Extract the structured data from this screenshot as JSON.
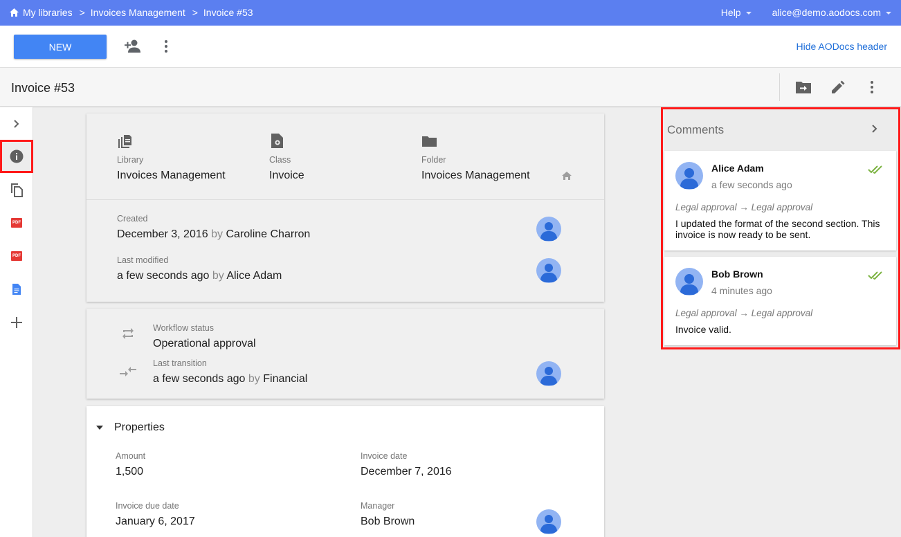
{
  "header": {
    "breadcrumbs": [
      "My libraries",
      "Invoices Management",
      "Invoice #53"
    ],
    "help_label": "Help",
    "user_email": "alice@demo.aodocs.com"
  },
  "actionbar": {
    "new_label": "NEW",
    "hide_header_label": "Hide AODocs header"
  },
  "document": {
    "title": "Invoice #53"
  },
  "summary": {
    "library_label": "Library",
    "library_value": "Invoices Management",
    "class_label": "Class",
    "class_value": "Invoice",
    "folder_label": "Folder",
    "folder_value": "Invoices Management",
    "created_label": "Created",
    "created_date": "December 3, 2016",
    "created_by_word": "by",
    "created_by": "Caroline Charron",
    "modified_label": "Last modified",
    "modified_date": "a few seconds ago",
    "modified_by_word": "by",
    "modified_by": "Alice Adam"
  },
  "workflow": {
    "status_label": "Workflow status",
    "status_value": "Operational approval",
    "transition_label": "Last transition",
    "transition_date": "a few seconds ago",
    "transition_by_word": "by",
    "transition_by": "Financial"
  },
  "properties": {
    "heading": "Properties",
    "amount_label": "Amount",
    "amount_value": "1,500",
    "invoice_date_label": "Invoice date",
    "invoice_date_value": "December 7, 2016",
    "due_date_label": "Invoice due date",
    "due_date_value": "January 6, 2017",
    "manager_label": "Manager",
    "manager_value": "Bob Brown"
  },
  "comments": {
    "title": "Comments",
    "items": [
      {
        "author": "Alice Adam",
        "time": "a few seconds ago",
        "transition": "Legal approval → Legal approval",
        "text": "I updated the format of the second section. This invoice is now ready to be sent."
      },
      {
        "author": "Bob Brown",
        "time": "4 minutes ago",
        "transition": "Legal approval → Legal approval",
        "text": "Invoice valid."
      }
    ]
  },
  "colors": {
    "header_blue": "#5b7ff0",
    "primary_button": "#4285f4",
    "link": "#1e6ed9",
    "highlight_outline": "#ff1a1a",
    "check_green": "#7cb342",
    "pdf_red": "#e53935"
  },
  "icons": {
    "rail": [
      "chevron-right-icon",
      "info-icon",
      "copy-icon",
      "pdf-icon",
      "pdf-icon",
      "doc-icon",
      "plus-icon"
    ],
    "title_actions": [
      "move-to-folder-icon",
      "edit-pencil-icon",
      "more-vert-icon"
    ]
  }
}
